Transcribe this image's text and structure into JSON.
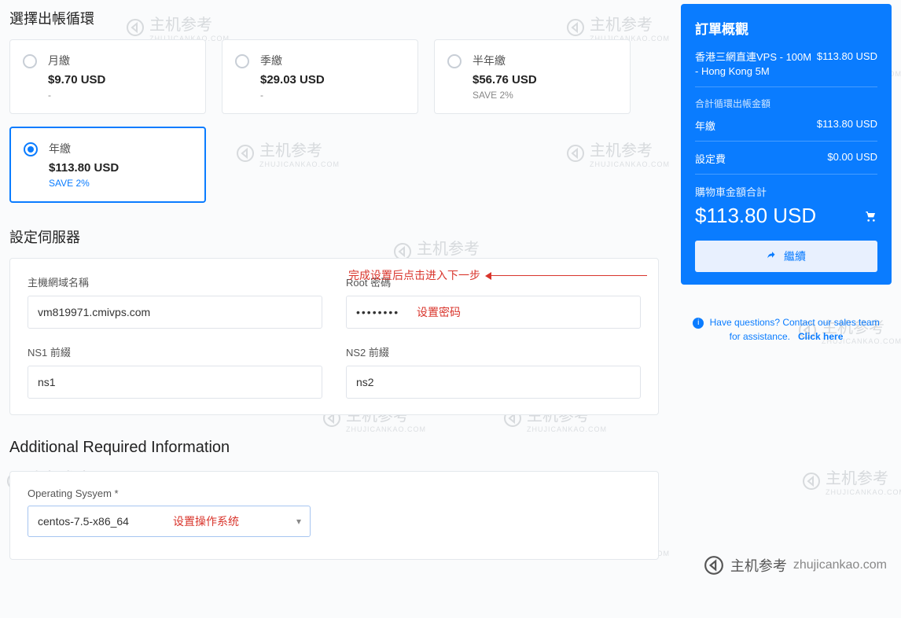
{
  "sections": {
    "billing_title": "選擇出帳循環",
    "server_title": "設定伺服器",
    "addl_title": "Additional Required Information"
  },
  "billing": {
    "monthly": {
      "label": "月繳",
      "price": "$9.70 USD",
      "save": "-"
    },
    "quarterly": {
      "label": "季繳",
      "price": "$29.03 USD",
      "save": "-"
    },
    "semi": {
      "label": "半年繳",
      "price": "$56.76 USD",
      "save": "SAVE 2%"
    },
    "annual": {
      "label": "年繳",
      "price": "$113.80 USD",
      "save": "SAVE 2%"
    }
  },
  "server": {
    "hostname_label": "主機網域名稱",
    "hostname_value": "vm819971.cmivps.com",
    "rootpw_label": "Root 密碼",
    "rootpw_value": "••••••••",
    "rootpw_note": "设置密码",
    "ns1_label": "NS1 前綴",
    "ns1_value": "ns1",
    "ns2_label": "NS2 前綴",
    "ns2_value": "ns2"
  },
  "os": {
    "label": "Operating Sysyem *",
    "value": "centos-7.5-x86_64",
    "note": "设置操作系统"
  },
  "summary": {
    "title": "訂單概觀",
    "item_name": "香港三網直連VPS - 100M - Hong Kong 5M",
    "item_price": "$113.80 USD",
    "recur_label": "合計循環出帳金額",
    "annual_label": "年繳",
    "annual_price": "$113.80 USD",
    "setup_label": "設定費",
    "setup_price": "$0.00 USD",
    "cart_label": "購物車金額合計",
    "cart_total": "$113.80 USD",
    "continue": "繼續"
  },
  "help": {
    "text": "Have questions? Contact our sales team for assistance.",
    "link": "Click here"
  },
  "annot": {
    "arrow": "完成设置后点击进入下一步"
  },
  "watermark": {
    "text": "主机参考",
    "sub": "ZHUJICANKAO.COM",
    "domain": "zhujicankao.com"
  }
}
